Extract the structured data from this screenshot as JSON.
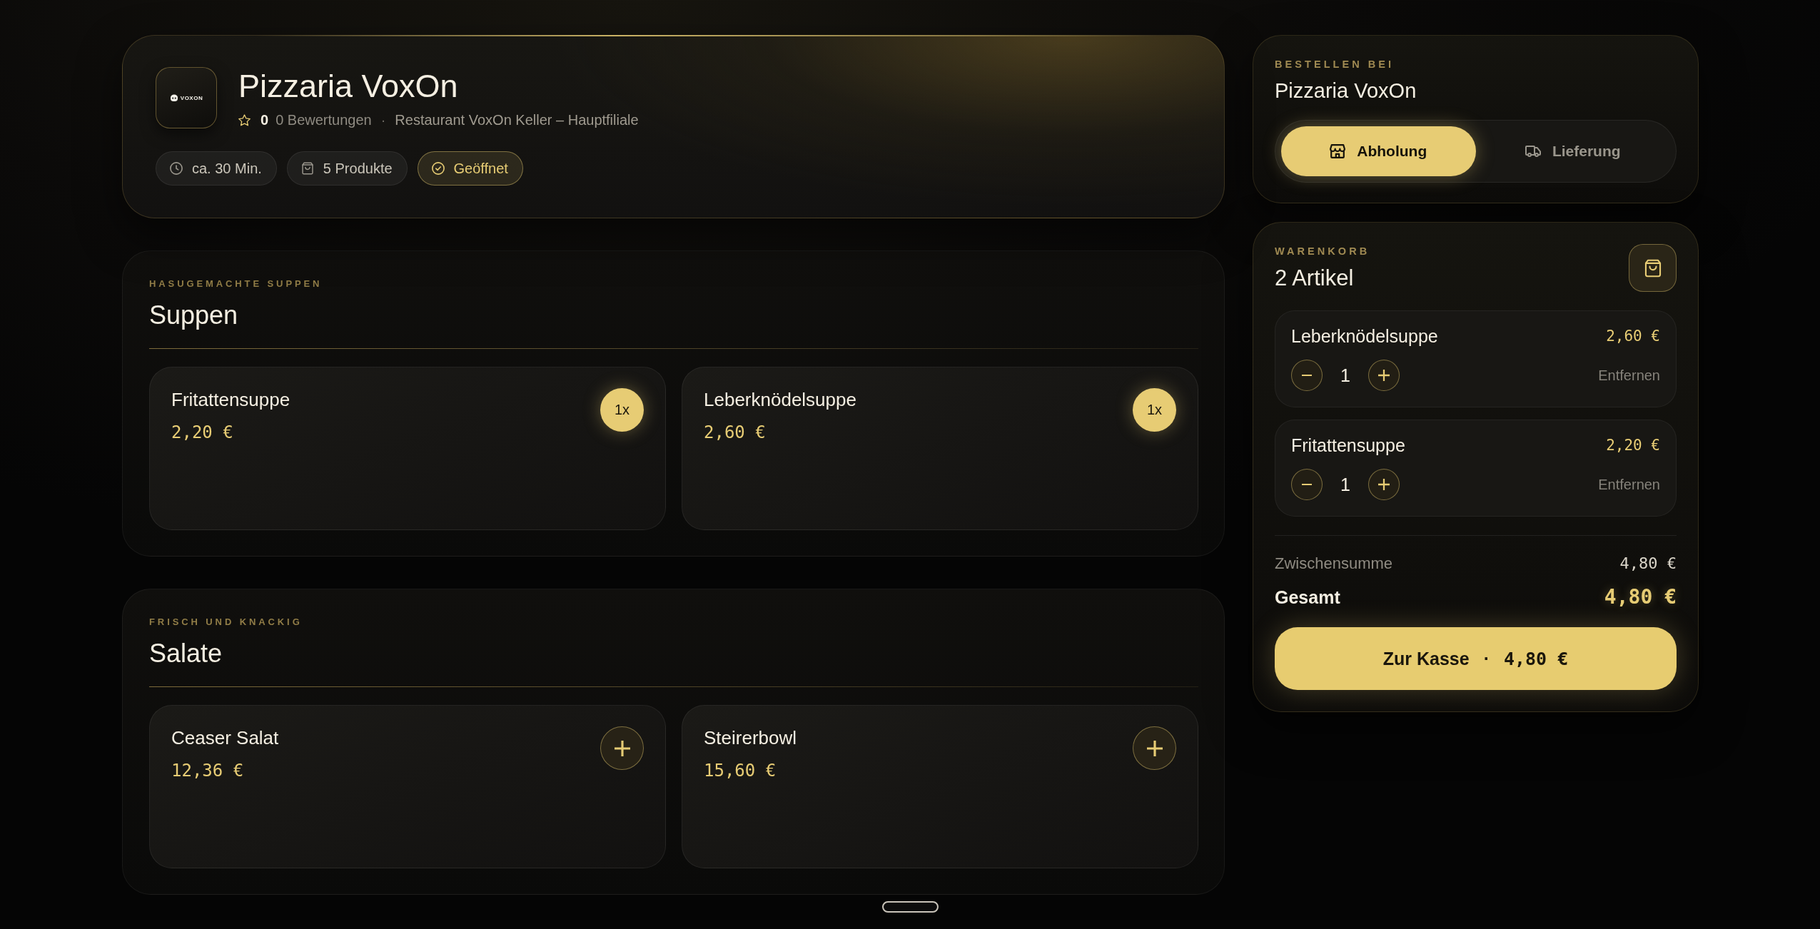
{
  "restaurant": {
    "logo_text": "VOXON",
    "name": "Pizzaria VoxOn",
    "rating": "0",
    "reviews": "0 Bewertungen",
    "separator": "·",
    "branch": "Restaurant VoxOn Keller – Hauptfiliale",
    "chips": [
      {
        "kind": "time",
        "label": "ca. 30 Min.",
        "highlighted": false
      },
      {
        "kind": "products",
        "label": "5 Produkte",
        "highlighted": false
      },
      {
        "kind": "status",
        "label": "Geöffnet",
        "highlighted": true
      }
    ]
  },
  "sections": [
    {
      "eyebrow": "HASUGEMACHTE SUPPEN",
      "title": "Suppen",
      "products": [
        {
          "name": "Fritattensuppe",
          "price": "2,20 €",
          "in_cart": true,
          "badge": "1x"
        },
        {
          "name": "Leberknödelsuppe",
          "price": "2,60 €",
          "in_cart": true,
          "badge": "1x"
        }
      ]
    },
    {
      "eyebrow": "FRISCH UND KNACKIG",
      "title": "Salate",
      "products": [
        {
          "name": "Ceaser Salat",
          "price": "12,36 €",
          "in_cart": false
        },
        {
          "name": "Steirerbowl",
          "price": "15,60 €",
          "in_cart": false
        }
      ]
    }
  ],
  "order_panel": {
    "eyebrow": "BESTELLEN BEI",
    "restaurant": "Pizzaria VoxOn",
    "modes": [
      {
        "kind": "pickup",
        "label": "Abholung",
        "selected": true
      },
      {
        "kind": "delivery",
        "label": "Lieferung",
        "selected": false
      }
    ]
  },
  "cart": {
    "eyebrow": "WARENKORB",
    "title": "2 Artikel",
    "items": [
      {
        "name": "Leberknödelsuppe",
        "price": "2,60 €",
        "quantity": "1",
        "remove": "Entfernen"
      },
      {
        "name": "Fritattensuppe",
        "price": "2,20 €",
        "quantity": "1",
        "remove": "Entfernen"
      }
    ],
    "subtotal": {
      "label": "Zwischensumme",
      "value": "4,80 €"
    },
    "total": {
      "label": "Gesamt",
      "value": "4,80 €"
    },
    "checkout": {
      "label": "Zur Kasse",
      "separator": "·",
      "amount": "4,80 €"
    }
  }
}
